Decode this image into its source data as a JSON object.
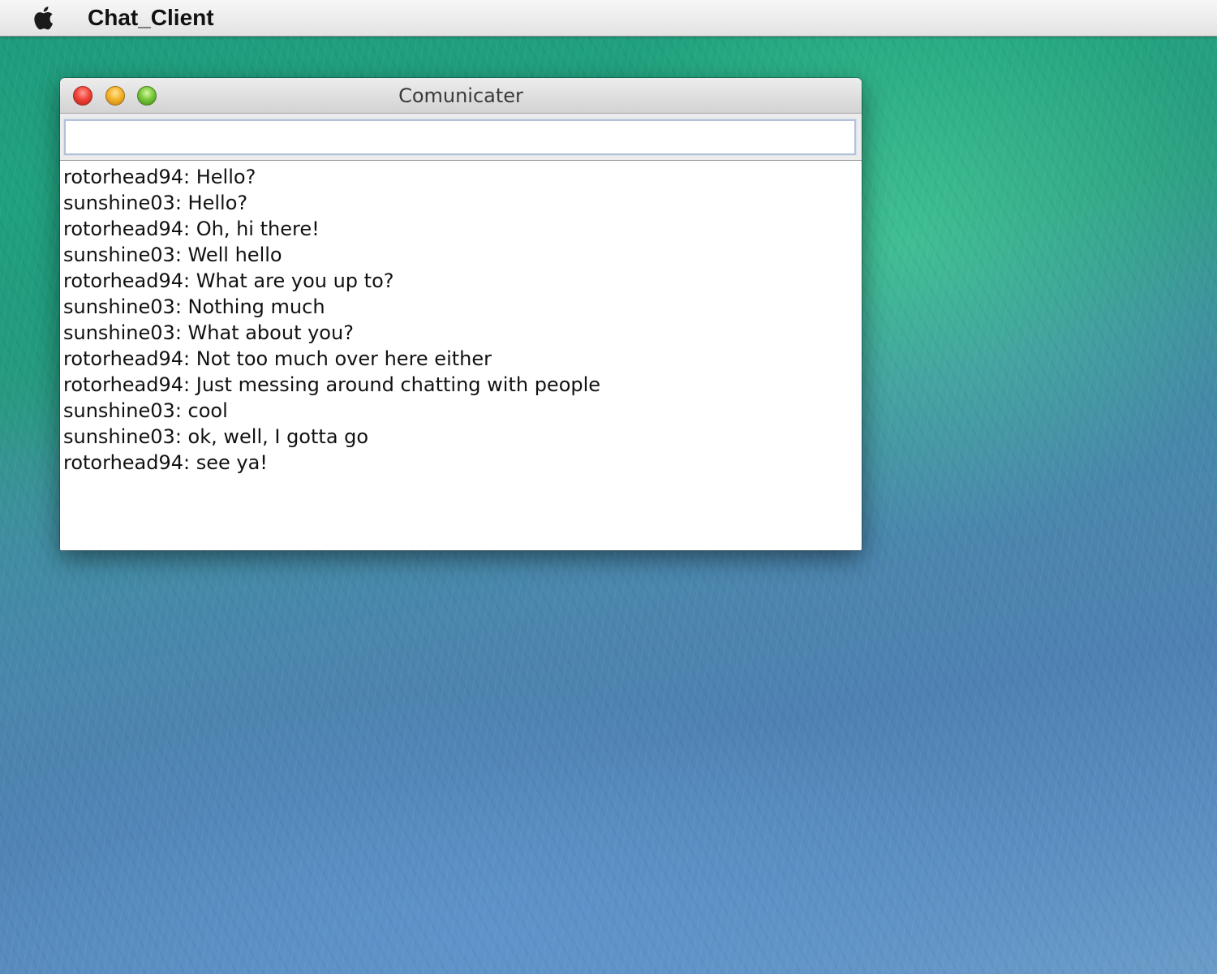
{
  "menubar": {
    "apple_icon": "apple-logo-icon",
    "app_name": "Chat_Client"
  },
  "window": {
    "title": "Comunicater",
    "controls": [
      "close-button",
      "minimize-button",
      "zoom-button"
    ],
    "input": {
      "value": "",
      "placeholder": ""
    },
    "messages": [
      "rotorhead94: Hello?",
      "sunshine03: Hello?",
      "rotorhead94: Oh, hi there!",
      "sunshine03: Well hello",
      "rotorhead94: What are you up to?",
      "sunshine03: Nothing much",
      "sunshine03: What about you?",
      "rotorhead94: Not too much over here either",
      "rotorhead94: Just messing around chatting with people",
      "sunshine03: cool",
      "sunshine03: ok, well, I gotta go",
      "rotorhead94: see ya!"
    ]
  },
  "colors": {
    "close": "#f0443a",
    "minimize": "#f4b42a",
    "zoom": "#79c83c"
  }
}
